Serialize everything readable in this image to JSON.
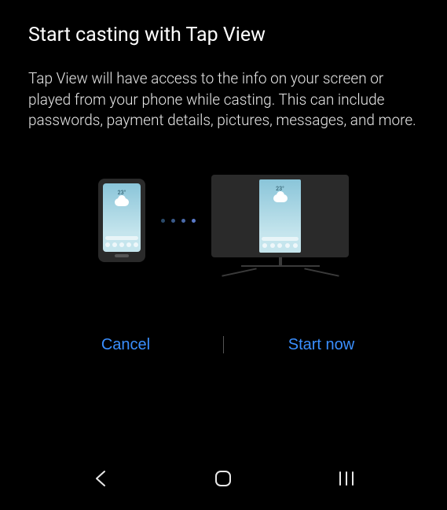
{
  "dialog": {
    "title": "Start casting with Tap View",
    "description": "Tap View will have access to the info on your screen or played from your phone while casting. This can include passwords, payment details, pictures, messages, and more.",
    "illustration": {
      "temperature": "23°"
    },
    "buttons": {
      "cancel": "Cancel",
      "confirm": "Start now"
    }
  }
}
